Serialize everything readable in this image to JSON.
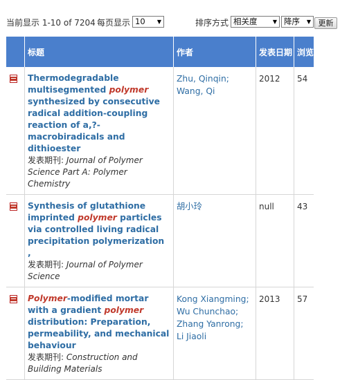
{
  "toolbar": {
    "current_display": "当前显示 1-10 of 7204",
    "per_page_label": "每页显示",
    "per_page_value": "10",
    "sort_label": "排序方式",
    "sort_value": "相关度",
    "order_value": "降序",
    "update_label": "更新"
  },
  "table": {
    "headers": {
      "title": "标题",
      "author": "作者",
      "date": "发表日期",
      "views": "浏览"
    },
    "rows": [
      {
        "title_parts": [
          "Thermodegradable multisegmented ",
          "polymer",
          " synthesized by consecutive radical addition-coupling reaction of a,?-macrobiradicals and dithioester"
        ],
        "journal_label": "发表期刊:",
        "journal": " Journal of Polymer Science Part A: Polymer Chemistry",
        "authors": "Zhu, Qinqin; Wang, Qi",
        "date": "2012",
        "views": "54"
      },
      {
        "title_parts": [
          "Synthesis of glutathione imprinted ",
          "polymer",
          " particles via controlled living radical precipitation polymerization ,"
        ],
        "journal_label": "发表期刊:",
        "journal": " Journal of Polymer Science",
        "authors": "胡小玲",
        "date": "null",
        "views": "43"
      },
      {
        "title_parts": [
          "Polymer",
          "-modified mortar with a gradient ",
          "polymer",
          " distribution: Preparation, permeability, and mechanical behaviour"
        ],
        "journal_label": "发表期刊:",
        "journal": " Construction and Building Materials",
        "authors": "Kong Xiangming; Wu Chunchao; Zhang Yanrong; Li Jiaoli",
        "date": "2013",
        "views": "57"
      }
    ]
  },
  "colors": {
    "header_bg": "#4a7fcc",
    "link": "#2e6da4",
    "highlight": "#c0392b"
  },
  "icons": {
    "row_icon": "pdf-icon",
    "dropdown": "chevron-down-icon"
  }
}
